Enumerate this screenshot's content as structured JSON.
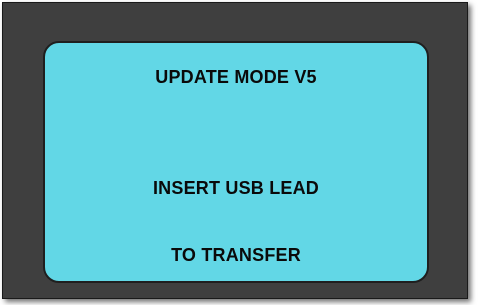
{
  "display": {
    "line1": "UPDATE MODE V5",
    "line2": "INSERT USB LEAD",
    "line3": "TO TRANSFER"
  },
  "colors": {
    "bezel": "#3f3f3f",
    "screen": "#62d7e6",
    "text": "#0a0a0a"
  }
}
